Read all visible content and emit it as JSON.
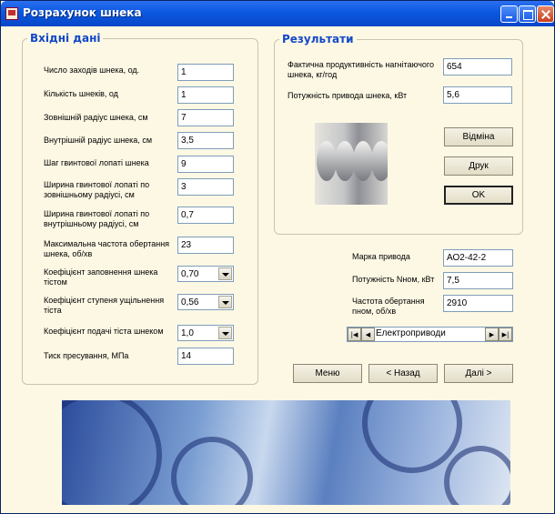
{
  "window": {
    "title": "Розрахунок шнека"
  },
  "inputs": {
    "legend": "Вхідні дані",
    "fields": [
      {
        "label": "Число заходів шнека, од.",
        "value": "1"
      },
      {
        "label": "Кількість шнеків, од",
        "value": "1"
      },
      {
        "label": "Зовнішній радіус шнека, см",
        "value": "7"
      },
      {
        "label": "Внутрішній радіус шнека, см",
        "value": "3,5"
      },
      {
        "label": "Шаг гвинтової лопаті шнека",
        "value": "9"
      },
      {
        "label": "Ширина гвинтової лопаті по зовнішньому радіусі, см",
        "value": "3"
      },
      {
        "label": "Ширина гвинтової лопаті по внутрішньому радіусі, см",
        "value": "0,7"
      },
      {
        "label": "Максимальна частота обертання шнека, об/хв",
        "value": "23"
      },
      {
        "label": "Коефіцієнт заповнення шнека тістом",
        "value": "0,70"
      },
      {
        "label": "Коефіцієнт ступеня ущільнення тіста",
        "value": "0,56"
      },
      {
        "label": "Коефіцієнт  подачі тіста шнеком",
        "value": "1,0"
      },
      {
        "label": "Тиск пресування, МПа",
        "value": "14"
      }
    ]
  },
  "results": {
    "legend": "Результати",
    "fields": [
      {
        "label": "Фактична продуктивність нагнітаючого шнека, кг/год",
        "value": "654"
      },
      {
        "label": "Потужність привода шнека, кВт",
        "value": "5,6"
      }
    ],
    "buttons": {
      "cancel": "Відміна",
      "print": "Друк",
      "ok": "OK"
    }
  },
  "drive": {
    "fields": [
      {
        "label": "Марка привода",
        "value": "АО2-42-2"
      },
      {
        "label": "Потужність Nном, кВт",
        "value": "7,5"
      },
      {
        "label": "Частота обертання nном, об/хв",
        "value": "2910"
      }
    ],
    "navigator": {
      "caption": "Електроприводи"
    }
  },
  "footer": {
    "menu": "Меню",
    "back": "< Назад",
    "next": "Далі >"
  }
}
